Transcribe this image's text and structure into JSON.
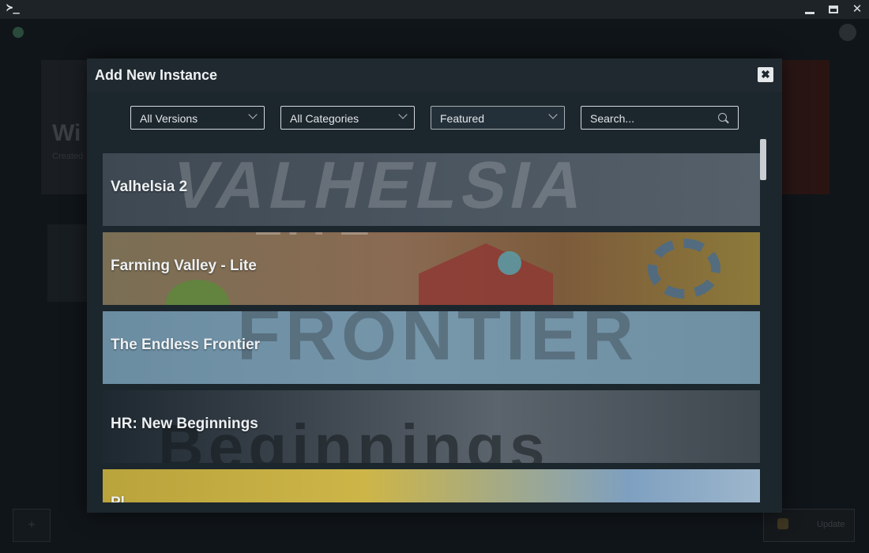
{
  "window": {
    "terminal_glyph": "≻_",
    "minimize_icon": "minimize-icon",
    "maximize_icon": "maximize-icon",
    "close_glyph": "✕"
  },
  "background_app": {
    "hero_title": "Wi",
    "hero_subtitle": "Created",
    "plus_glyph": "+",
    "update_label": "Update"
  },
  "modal": {
    "title": "Add New Instance",
    "close_glyph": "✖",
    "filters": {
      "versions": "All Versions",
      "categories": "All Categories",
      "sort": "Featured"
    },
    "search": {
      "placeholder": "Search..."
    },
    "instances": [
      {
        "title": "Valhelsia 2",
        "art_text": "VALHELSIA"
      },
      {
        "title": "Farming Valley - Lite",
        "art_text": "LITE"
      },
      {
        "title": "The Endless Frontier",
        "art_text": "FRONTIER"
      },
      {
        "title": "HR: New Beginnings",
        "art_text": "Beginnings"
      },
      {
        "title": "Pl",
        "art_text": ""
      }
    ]
  },
  "colors": {
    "modal_bg": "#1c262d",
    "app_bg": "#101519",
    "text": "#eef1f3"
  }
}
